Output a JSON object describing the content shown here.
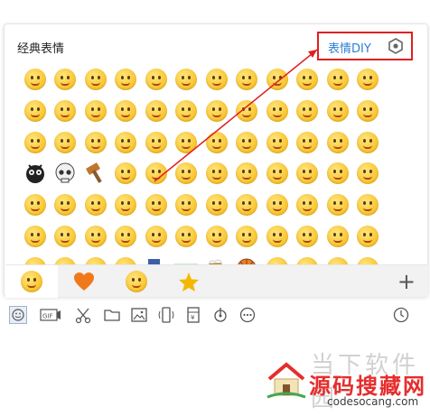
{
  "panel": {
    "title": "经典表情",
    "diy_label": "表情DIY",
    "settings_icon": "hexagon-gear-icon"
  },
  "emoji_grid": {
    "rows": 7,
    "columns": 12,
    "count": 84,
    "special_items": [
      {
        "index": 36,
        "name": "black-bug-emoji-icon"
      },
      {
        "index": 37,
        "name": "skull-emoji-icon"
      },
      {
        "index": 38,
        "name": "hammer-emoji-icon"
      },
      {
        "index": 76,
        "name": "knife-emoji-icon"
      },
      {
        "index": 77,
        "name": "watermelon-emoji-icon"
      },
      {
        "index": 78,
        "name": "beer-emoji-icon"
      },
      {
        "index": 79,
        "name": "basketball-emoji-icon"
      }
    ]
  },
  "tabs": [
    {
      "name": "classic-faces",
      "icon": "smiley-icon",
      "active": true
    },
    {
      "name": "favorites",
      "icon": "heart-icon",
      "active": false
    },
    {
      "name": "big-emoji",
      "icon": "grin-icon",
      "active": false
    },
    {
      "name": "starred",
      "icon": "star-icon",
      "active": false
    }
  ],
  "add_button": "+",
  "toolbar_icons": [
    "emoji-icon",
    "gif-icon",
    "scissors-icon",
    "folder-icon",
    "image-icon",
    "shake-icon",
    "red-packet-icon",
    "music-icon",
    "more-icon",
    "history-clock-icon"
  ],
  "watermark": {
    "grey_text": "当下软件园",
    "red_text": "源码搜藏网",
    "url": "codesocang.com"
  },
  "colors": {
    "highlight_red": "#e02020",
    "link_blue": "#2a7fd4",
    "face_yellow": "#f9c22a",
    "heart_orange": "#f07a1a",
    "star_yellow": "#f5b800"
  }
}
